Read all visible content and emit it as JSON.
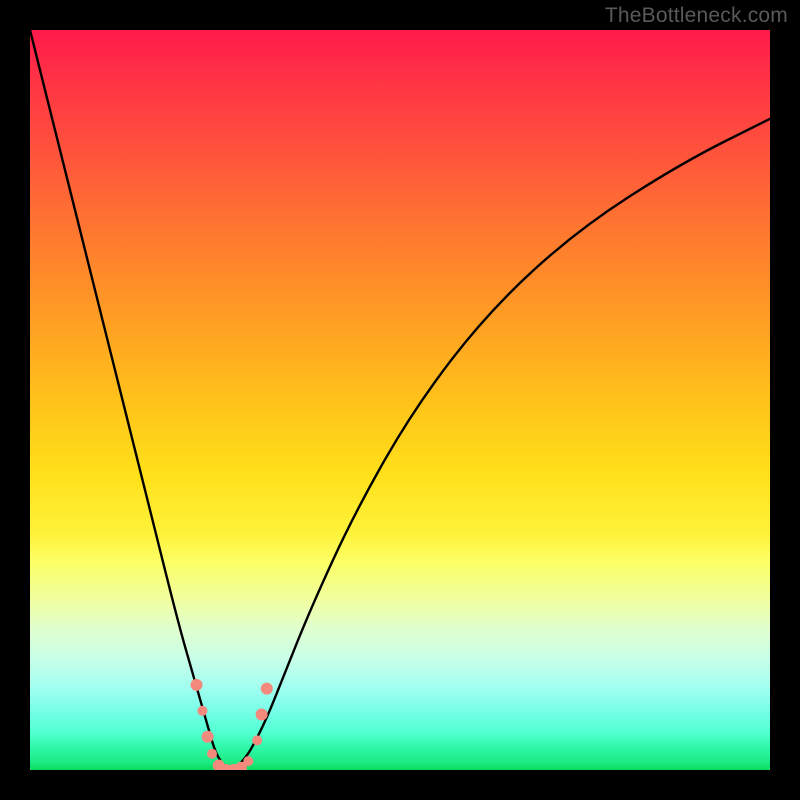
{
  "watermark": "TheBottleneck.com",
  "chart_data": {
    "type": "line",
    "title": "",
    "xlabel": "",
    "ylabel": "",
    "xlim": [
      0,
      100
    ],
    "ylim": [
      0,
      100
    ],
    "background_gradient": {
      "top_color": "#ff1a4a",
      "mid_color": "#ffe01a",
      "bottom_color": "#0bda5d",
      "meaning": "red = high bottleneck, green = low bottleneck"
    },
    "curve": {
      "description": "V-shaped bottleneck curve; minimum near x≈27 at y≈0",
      "x": [
        0,
        4,
        8,
        12,
        16,
        20,
        22,
        24,
        25,
        26,
        27,
        28,
        29,
        30,
        32,
        34,
        38,
        44,
        52,
        62,
        74,
        88,
        100
      ],
      "y": [
        100,
        84,
        68,
        52,
        36,
        20,
        13,
        6,
        2.5,
        0.8,
        0,
        0.5,
        1.5,
        3,
        7,
        12,
        22,
        35,
        49,
        62,
        73,
        82,
        88
      ]
    },
    "markers": {
      "description": "salmon-colored dots clustered around curve minimum",
      "color": "#f48a7e",
      "points": [
        {
          "x": 22.5,
          "y": 11.5,
          "r": 6
        },
        {
          "x": 23.3,
          "y": 8.0,
          "r": 5
        },
        {
          "x": 24.0,
          "y": 4.5,
          "r": 6
        },
        {
          "x": 24.6,
          "y": 2.2,
          "r": 5
        },
        {
          "x": 25.5,
          "y": 0.6,
          "r": 6
        },
        {
          "x": 26.5,
          "y": 0.0,
          "r": 6
        },
        {
          "x": 27.5,
          "y": 0.0,
          "r": 6
        },
        {
          "x": 28.5,
          "y": 0.3,
          "r": 6
        },
        {
          "x": 29.5,
          "y": 1.2,
          "r": 5
        },
        {
          "x": 30.7,
          "y": 4.0,
          "r": 5
        },
        {
          "x": 31.3,
          "y": 7.5,
          "r": 6
        },
        {
          "x": 32.0,
          "y": 11.0,
          "r": 6
        }
      ]
    }
  }
}
